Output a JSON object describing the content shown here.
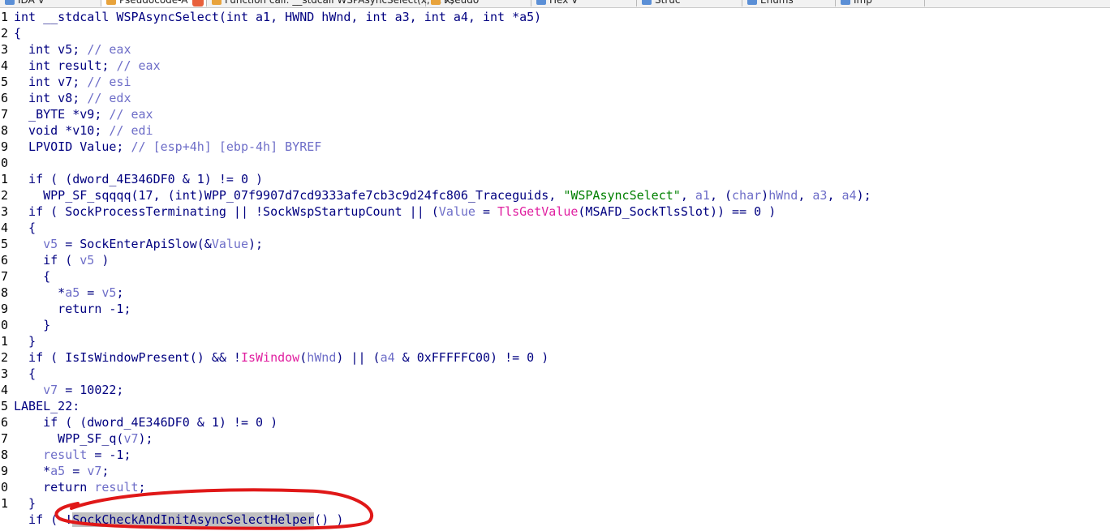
{
  "tabs": [
    {
      "label": "IDA V",
      "active": false
    },
    {
      "label": "Pseudocode-A",
      "active": true
    },
    {
      "label": "Function call: __stdcall WSPAsyncSelect(x, x, x,",
      "active": false
    },
    {
      "label": "Pseudo",
      "active": false
    },
    {
      "label": "Hex V",
      "active": false
    },
    {
      "label": "Struc",
      "active": false
    },
    {
      "label": "Enums",
      "active": false
    },
    {
      "label": "Imp",
      "active": false
    }
  ],
  "code_lines": [
    {
      "n": "1",
      "segs": [
        {
          "t": "int __stdcall WSPAsyncSelect(int a1, HWND hWnd, int a3, int a4, int *a5)",
          "c": "k"
        }
      ]
    },
    {
      "n": "2",
      "segs": [
        {
          "t": "{",
          "c": "k"
        }
      ]
    },
    {
      "n": "3",
      "segs": [
        {
          "t": "  int v5; ",
          "c": "k"
        },
        {
          "t": "// eax",
          "c": "c"
        }
      ]
    },
    {
      "n": "4",
      "segs": [
        {
          "t": "  int result; ",
          "c": "k"
        },
        {
          "t": "// eax",
          "c": "c"
        }
      ]
    },
    {
      "n": "5",
      "segs": [
        {
          "t": "  int v7; ",
          "c": "k"
        },
        {
          "t": "// esi",
          "c": "c"
        }
      ]
    },
    {
      "n": "6",
      "segs": [
        {
          "t": "  int v8; ",
          "c": "k"
        },
        {
          "t": "// edx",
          "c": "c"
        }
      ]
    },
    {
      "n": "7",
      "segs": [
        {
          "t": "  _BYTE *v9; ",
          "c": "k"
        },
        {
          "t": "// eax",
          "c": "c"
        }
      ]
    },
    {
      "n": "8",
      "segs": [
        {
          "t": "  void *v10; ",
          "c": "k"
        },
        {
          "t": "// edi",
          "c": "c"
        }
      ]
    },
    {
      "n": "9",
      "segs": [
        {
          "t": "  LPVOID Value; ",
          "c": "k"
        },
        {
          "t": "// [esp+4h] [ebp-4h] BYREF",
          "c": "c"
        }
      ]
    },
    {
      "n": "0",
      "segs": [
        {
          "t": "",
          "c": "k"
        }
      ]
    },
    {
      "n": "1",
      "segs": [
        {
          "t": "  if ( (dword_4E346DF0 & 1) != 0 )",
          "c": "k"
        }
      ]
    },
    {
      "n": "2",
      "segs": [
        {
          "t": "    WPP_SF_sqqqq(17, (int)WPP_07f9907d7cd9333afe7cb3c9d24fc806_Traceguids, ",
          "c": "k"
        },
        {
          "t": "\"WSPAsyncSelect\"",
          "c": "s"
        },
        {
          "t": ", ",
          "c": "k"
        },
        {
          "t": "a1",
          "c": "v"
        },
        {
          "t": ", (",
          "c": "k"
        },
        {
          "t": "char",
          "c": "v"
        },
        {
          "t": ")",
          "c": "k"
        },
        {
          "t": "hWnd",
          "c": "v"
        },
        {
          "t": ", ",
          "c": "k"
        },
        {
          "t": "a3",
          "c": "v"
        },
        {
          "t": ", ",
          "c": "k"
        },
        {
          "t": "a4",
          "c": "v"
        },
        {
          "t": ");",
          "c": "k"
        }
      ]
    },
    {
      "n": "3",
      "segs": [
        {
          "t": "  if ( SockProcessTerminating || !SockWspStartupCount || (",
          "c": "k"
        },
        {
          "t": "Value",
          "c": "v"
        },
        {
          "t": " = ",
          "c": "k"
        },
        {
          "t": "TlsGetValue",
          "c": "f"
        },
        {
          "t": "(MSAFD_SockTlsSlot)) == 0 )",
          "c": "k"
        }
      ]
    },
    {
      "n": "4",
      "segs": [
        {
          "t": "  {",
          "c": "k"
        }
      ]
    },
    {
      "n": "5",
      "segs": [
        {
          "t": "    ",
          "c": "k"
        },
        {
          "t": "v5",
          "c": "v"
        },
        {
          "t": " = SockEnterApiSlow(&",
          "c": "k"
        },
        {
          "t": "Value",
          "c": "v"
        },
        {
          "t": ");",
          "c": "k"
        }
      ]
    },
    {
      "n": "6",
      "segs": [
        {
          "t": "    if ( ",
          "c": "k"
        },
        {
          "t": "v5",
          "c": "v"
        },
        {
          "t": " )",
          "c": "k"
        }
      ]
    },
    {
      "n": "7",
      "segs": [
        {
          "t": "    {",
          "c": "k"
        }
      ]
    },
    {
      "n": "8",
      "segs": [
        {
          "t": "      *",
          "c": "k"
        },
        {
          "t": "a5",
          "c": "v"
        },
        {
          "t": " = ",
          "c": "k"
        },
        {
          "t": "v5",
          "c": "v"
        },
        {
          "t": ";",
          "c": "k"
        }
      ]
    },
    {
      "n": "9",
      "segs": [
        {
          "t": "      return -1;",
          "c": "k"
        }
      ]
    },
    {
      "n": "0",
      "segs": [
        {
          "t": "    }",
          "c": "k"
        }
      ]
    },
    {
      "n": "1",
      "segs": [
        {
          "t": "  }",
          "c": "k"
        }
      ]
    },
    {
      "n": "2",
      "segs": [
        {
          "t": "  if ( IsIsWindowPresent() && !",
          "c": "k"
        },
        {
          "t": "IsWindow",
          "c": "f"
        },
        {
          "t": "(",
          "c": "k"
        },
        {
          "t": "hWnd",
          "c": "v"
        },
        {
          "t": ") || (",
          "c": "k"
        },
        {
          "t": "a4",
          "c": "v"
        },
        {
          "t": " & 0xFFFFFC00) != 0 )",
          "c": "k"
        }
      ]
    },
    {
      "n": "3",
      "segs": [
        {
          "t": "  {",
          "c": "k"
        }
      ]
    },
    {
      "n": "4",
      "segs": [
        {
          "t": "    ",
          "c": "k"
        },
        {
          "t": "v7",
          "c": "v"
        },
        {
          "t": " = 10022;",
          "c": "k"
        }
      ]
    },
    {
      "n": "5",
      "segs": [
        {
          "t": "LABEL_22:",
          "c": "k"
        }
      ]
    },
    {
      "n": "6",
      "segs": [
        {
          "t": "    if ( (dword_4E346DF0 & 1) != 0 )",
          "c": "k"
        }
      ]
    },
    {
      "n": "7",
      "segs": [
        {
          "t": "      WPP_SF_q(",
          "c": "k"
        },
        {
          "t": "v7",
          "c": "v"
        },
        {
          "t": ");",
          "c": "k"
        }
      ]
    },
    {
      "n": "8",
      "segs": [
        {
          "t": "    ",
          "c": "k"
        },
        {
          "t": "result",
          "c": "v"
        },
        {
          "t": " = -1;",
          "c": "k"
        }
      ]
    },
    {
      "n": "9",
      "segs": [
        {
          "t": "    *",
          "c": "k"
        },
        {
          "t": "a5",
          "c": "v"
        },
        {
          "t": " = ",
          "c": "k"
        },
        {
          "t": "v7",
          "c": "v"
        },
        {
          "t": ";",
          "c": "k"
        }
      ]
    },
    {
      "n": "0",
      "segs": [
        {
          "t": "    return ",
          "c": "k"
        },
        {
          "t": "result",
          "c": "v"
        },
        {
          "t": ";",
          "c": "k"
        }
      ]
    },
    {
      "n": "1",
      "segs": [
        {
          "t": "  }",
          "c": "k"
        }
      ]
    },
    {
      "n": "",
      "segs": [
        {
          "t": "  if ( !",
          "c": "k"
        },
        {
          "t": "SockCheckAndInitAsyncSelectHelper",
          "c": "h"
        },
        {
          "t": "() )",
          "c": "k"
        }
      ]
    }
  ],
  "colors": {
    "keyword": "#000080",
    "comment": "#6e6ec8",
    "string": "#008000",
    "import": "#e020a0",
    "highlight": "#c0c0c0",
    "annotation": "#e01818"
  }
}
